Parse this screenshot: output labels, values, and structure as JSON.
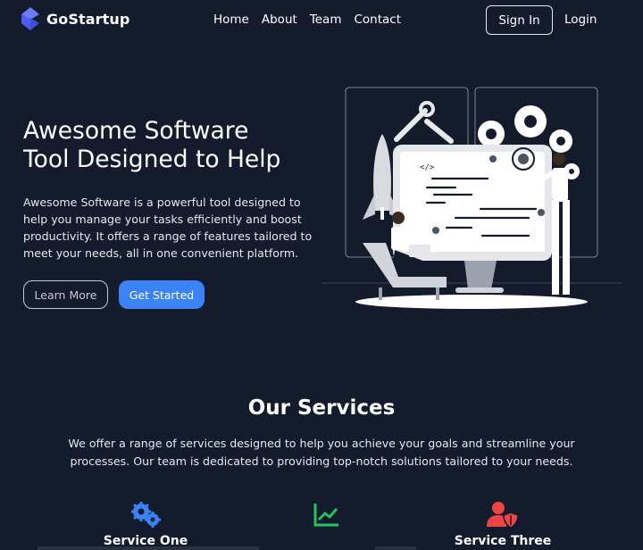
{
  "brand": {
    "name": "GoStartup"
  },
  "nav": {
    "links": [
      "Home",
      "About",
      "Team",
      "Contact"
    ],
    "sign_in": "Sign In",
    "login": "Login"
  },
  "hero": {
    "title_line1": "Awesome Software",
    "title_line2": "Tool Designed to Help",
    "text": "Awesome Software is a powerful tool designed to help you manage your tasks efficiently and boost productivity. It offers a range of features tailored to meet your needs, all in one convenient platform.",
    "learn_more": "Learn More",
    "get_started": "Get Started",
    "illustration_code_tag": "</>"
  },
  "services": {
    "title": "Our Services",
    "text": "We offer a range of services designed to help you achieve your goals and streamline your processes. Our team is dedicated to providing top-notch solutions tailored to your needs.",
    "items": [
      {
        "title": "Service One",
        "icon": "gears-icon",
        "color": "#3b82f6"
      },
      {
        "title": "",
        "icon": "chart-line-icon",
        "color": "#22c55e"
      },
      {
        "title": "Service Three",
        "icon": "user-shield-icon",
        "color": "#ef4444"
      }
    ]
  },
  "colors": {
    "background": "#141b2d",
    "accent": "#3b82f6"
  }
}
